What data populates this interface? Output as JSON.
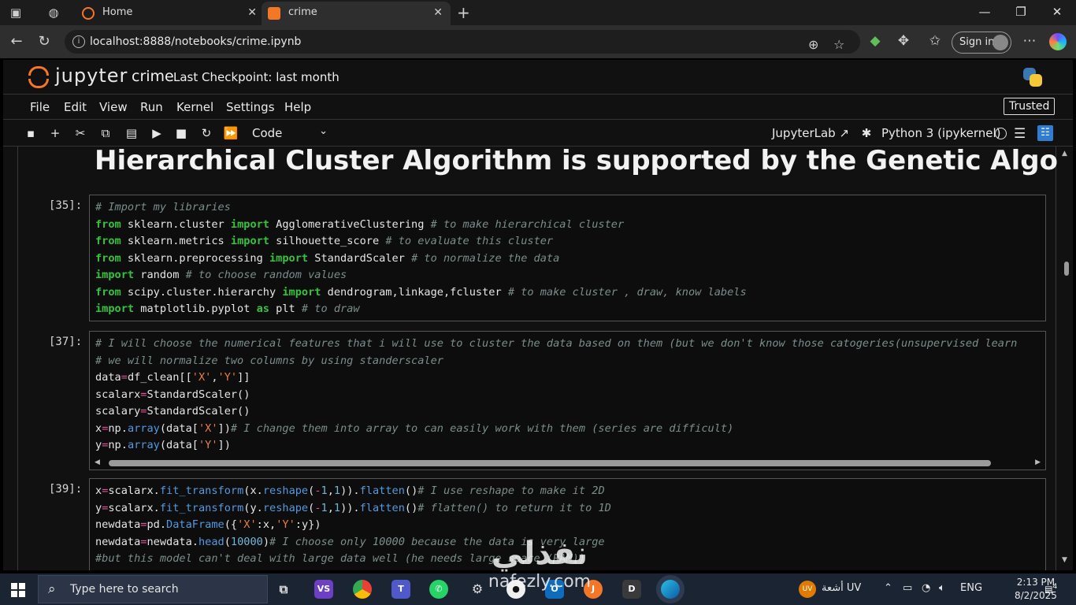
{
  "browser": {
    "tabs": [
      {
        "title": "Home",
        "active": false
      },
      {
        "title": "crime",
        "active": true
      }
    ],
    "url": "localhost:8888/notebooks/crime.ipynb",
    "sign_in": "Sign in"
  },
  "jupyter": {
    "logo_text": "jupyter",
    "notebook_name": "crime",
    "checkpoint": "Last Checkpoint: last month",
    "menu": [
      "File",
      "Edit",
      "View",
      "Run",
      "Kernel",
      "Settings",
      "Help"
    ],
    "trusted": "Trusted",
    "cell_type": "Code",
    "jupyterlab_link": "JupyterLab",
    "kernel_name": "Python 3 (ipykernel)"
  },
  "notebook": {
    "heading": "Hierarchical Cluster Algorithm is supported by the Genetic Algorithm.",
    "cells": [
      {
        "prompt": "[35]:",
        "lines": [
          "# Import my libraries",
          "from sklearn.cluster import AgglomerativeClustering # to make hierarchical cluster",
          "from sklearn.metrics import silhouette_score # to evaluate this cluster",
          "from sklearn.preprocessing import StandardScaler # to normalize the data",
          "import random # to choose random values",
          "from scipy.cluster.hierarchy import dendrogram,linkage,fcluster # to make cluster , draw, know labels",
          "import matplotlib.pyplot as plt # to draw"
        ]
      },
      {
        "prompt": "[37]:",
        "lines": [
          "# I will choose the numerical features that i will use to cluster the data based on them (but we don't know those catogeries(unsupervised learn",
          "# we will normalize two columns by using standerscaler",
          "data=df_clean[['X','Y']]",
          "scalarx=StandardScaler()",
          "scalary=StandardScaler()",
          "x=np.array(data['X'])# I change them into array to can easily work with them (series are difficult)",
          "y=np.array(data['Y'])"
        ]
      },
      {
        "prompt": "[39]:",
        "lines": [
          "x=scalarx.fit_transform(x.reshape(-1,1)).flatten()# I use reshape to make it 2D",
          "y=scalarx.fit_transform(y.reshape(-1,1)).flatten()# flatten() to return it to 1D",
          "newdata=pd.DataFrame({'X':x,'Y':y})",
          "newdata=newdata.head(10000)# I choose only 10000 because the data is very large",
          "#but this model can't deal with large data well (he needs large space (RAM))"
        ]
      }
    ]
  },
  "watermark": {
    "arabic": "نفذلي",
    "latin": "nafezly.com"
  },
  "taskbar": {
    "search_placeholder": "Type here to search",
    "apps": [
      "Task View",
      "Visual Studio",
      "Chrome",
      "Teams",
      "WhatsApp",
      "Settings",
      "GitHub",
      "Outlook",
      "Jupyter",
      "D",
      "Edge"
    ],
    "weather": "أشعة UV",
    "weather_badge": "UV",
    "language": "ENG",
    "time": "2:13 PM",
    "date": "8/2/2025",
    "notifications": "4"
  }
}
